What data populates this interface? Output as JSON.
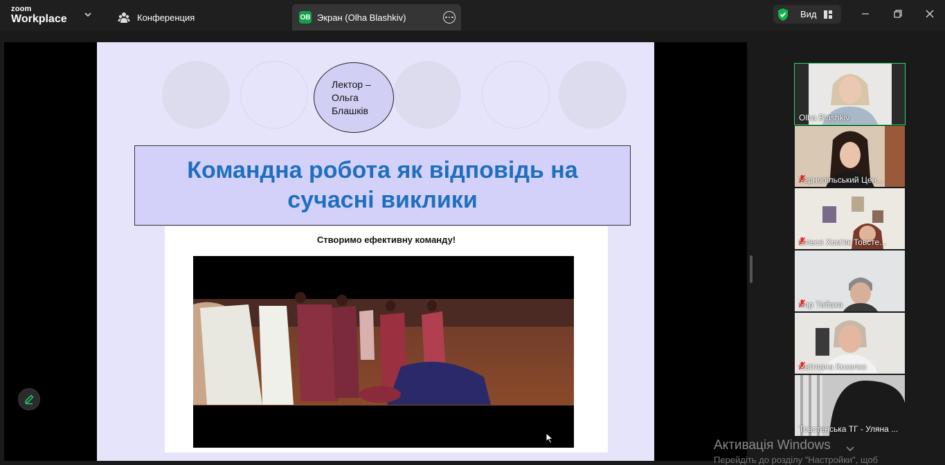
{
  "app": {
    "logo_small": "zoom",
    "logo_big": "Workplace"
  },
  "tabs": {
    "conference": "Конференция",
    "screen": "Экран (Olha Blashkiv)",
    "screen_badge": "OB"
  },
  "toolbar": {
    "view_label": "Вид"
  },
  "slide": {
    "lecturer": "Лектор – Ольга Блашків",
    "title": "Командна робота як відповідь на сучасні виклики",
    "video_caption": "Створимо ефективну команду!"
  },
  "participants": [
    {
      "name": "Olha Blashkiv",
      "muted": false,
      "active": true
    },
    {
      "name": "Тернопільський Цен...",
      "muted": true,
      "active": false
    },
    {
      "name": "Олеся Хом'як Товсте...",
      "muted": true,
      "active": false
    },
    {
      "name": "Ігор Табака",
      "muted": true,
      "active": false
    },
    {
      "name": "Світлана Козелко",
      "muted": true,
      "active": false
    },
    {
      "name": "Товстенська ТГ - Уляна ...",
      "muted": false,
      "active": false
    }
  ],
  "watermark": {
    "title": "Активація Windows",
    "subtitle": "Перейдіть до розділу \"Настройки\", щоб"
  },
  "colors": {
    "accent_green": "#23d96b",
    "slide_bg": "#e6e4fb",
    "title_blue": "#1f6fbe",
    "mute_red": "#e02828"
  },
  "icons": [
    "chevron-down-icon",
    "participants-icon",
    "more-icon",
    "shield-check-icon",
    "view-layout-icon",
    "minimize-icon",
    "restore-icon",
    "close-icon",
    "pencil-icon",
    "mic-muted-icon",
    "cursor-icon"
  ]
}
